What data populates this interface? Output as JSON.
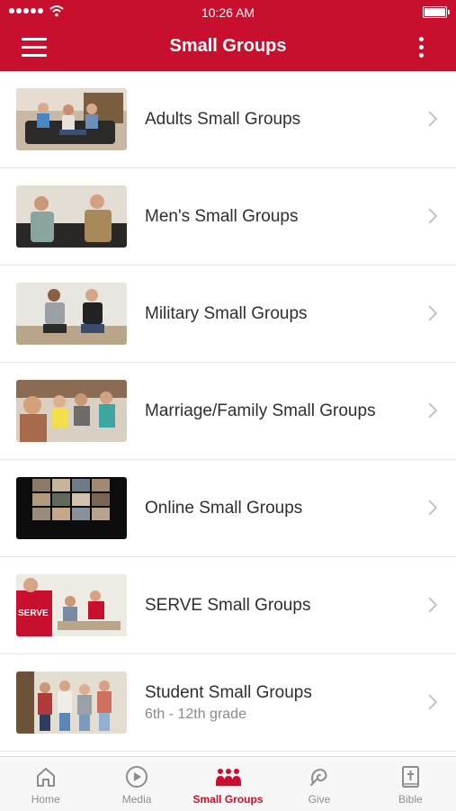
{
  "status_bar": {
    "time": "10:26 AM"
  },
  "header": {
    "title": "Small Groups"
  },
  "groups": [
    {
      "label": "Adults Small Groups",
      "subtitle": ""
    },
    {
      "label": "Men's Small Groups",
      "subtitle": ""
    },
    {
      "label": "Military Small Groups",
      "subtitle": ""
    },
    {
      "label": "Marriage/Family Small Groups",
      "subtitle": ""
    },
    {
      "label": "Online Small Groups",
      "subtitle": ""
    },
    {
      "label": "SERVE Small Groups",
      "subtitle": "",
      "thumb_text": "SERVE"
    },
    {
      "label": "Student Small Groups",
      "subtitle": "6th - 12th grade"
    }
  ],
  "tabbar": {
    "tabs": [
      {
        "label": "Home",
        "icon": "home-icon"
      },
      {
        "label": "Media",
        "icon": "play-icon"
      },
      {
        "label": "Small Groups",
        "icon": "group-icon",
        "active": true
      },
      {
        "label": "Give",
        "icon": "give-icon"
      },
      {
        "label": "Bible",
        "icon": "bible-icon"
      }
    ]
  },
  "colors": {
    "brand": "#c8102e",
    "tab_inactive": "#8d8d8d",
    "divider": "#e6e6e6"
  }
}
